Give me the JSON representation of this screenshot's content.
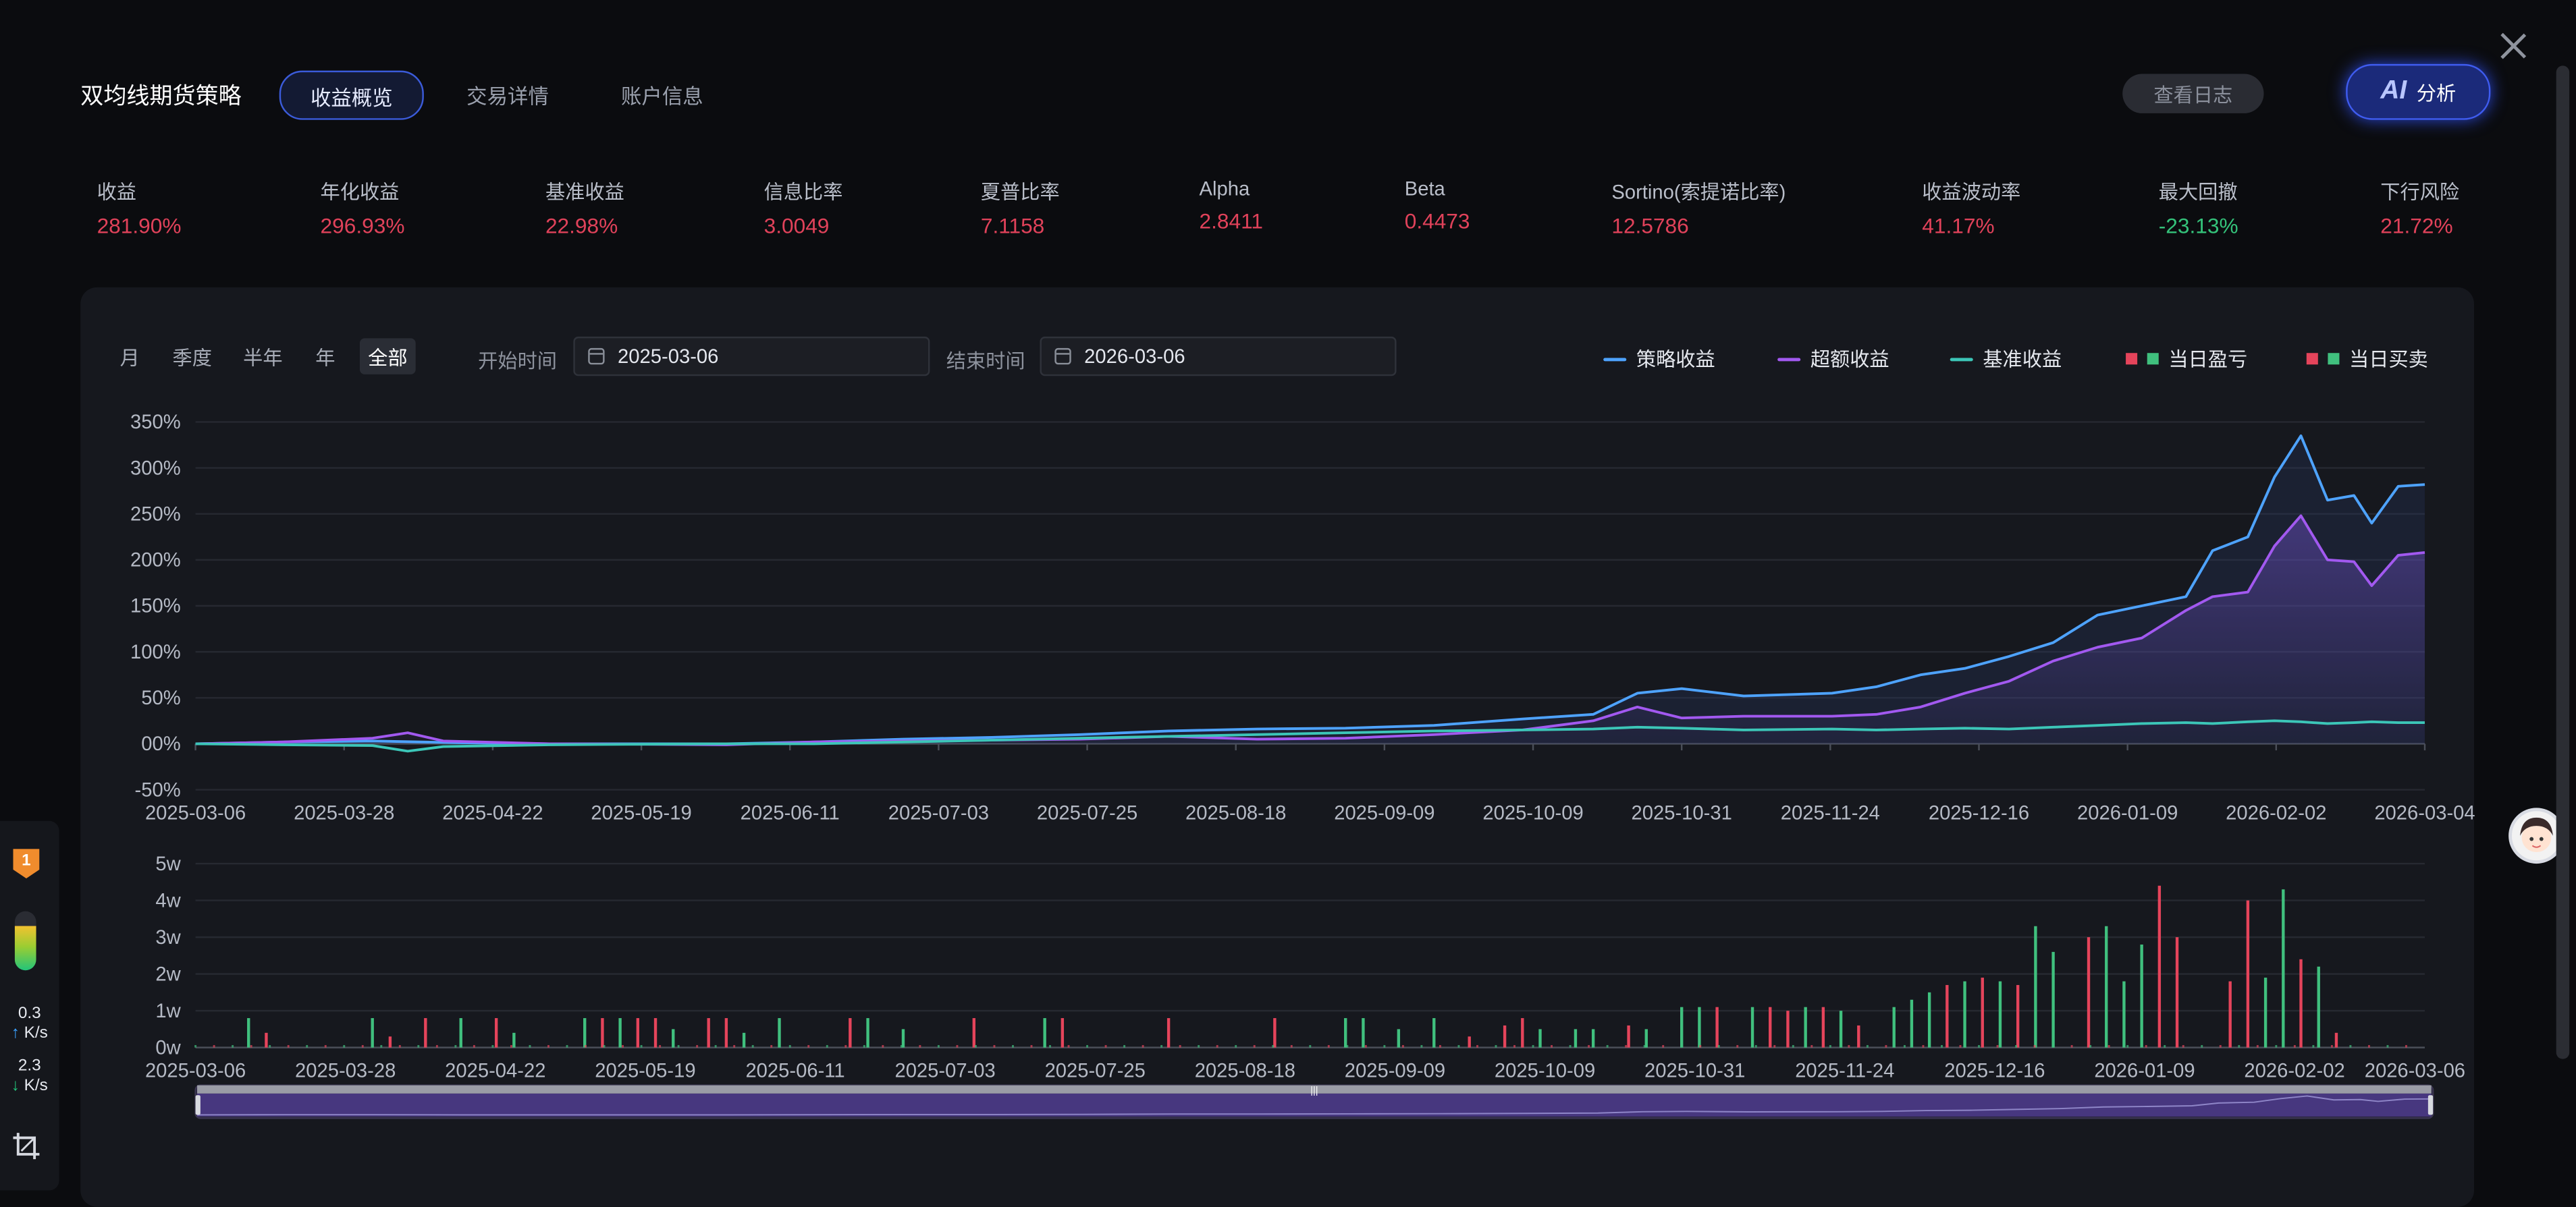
{
  "header": {
    "strategy_title": "双均线期货策略",
    "tabs": [
      {
        "label": "收益概览",
        "active": true
      },
      {
        "label": "交易详情",
        "active": false
      },
      {
        "label": "账户信息",
        "active": false
      }
    ],
    "log_button": "查看日志",
    "ai_button": {
      "ai": "AI",
      "label": "分析"
    }
  },
  "metrics": [
    {
      "label": "收益",
      "value": "281.90%",
      "tone": "red"
    },
    {
      "label": "年化收益",
      "value": "296.93%",
      "tone": "red"
    },
    {
      "label": "基准收益",
      "value": "22.98%",
      "tone": "red"
    },
    {
      "label": "信息比率",
      "value": "3.0049",
      "tone": "red"
    },
    {
      "label": "夏普比率",
      "value": "7.1158",
      "tone": "red"
    },
    {
      "label": "Alpha",
      "value": "2.8411",
      "tone": "red"
    },
    {
      "label": "Beta",
      "value": "0.4473",
      "tone": "red"
    },
    {
      "label": "Sortino(索提诺比率)",
      "value": "12.5786",
      "tone": "red"
    },
    {
      "label": "收益波动率",
      "value": "41.17%",
      "tone": "red"
    },
    {
      "label": "最大回撤",
      "value": "-23.13%",
      "tone": "green"
    },
    {
      "label": "下行风险",
      "value": "21.72%",
      "tone": "red"
    }
  ],
  "controls": {
    "periods": [
      {
        "label": "月",
        "active": false
      },
      {
        "label": "季度",
        "active": false
      },
      {
        "label": "半年",
        "active": false
      },
      {
        "label": "年",
        "active": false
      },
      {
        "label": "全部",
        "active": true
      }
    ],
    "start_label": "开始时间",
    "start_value": "2025-03-06",
    "end_label": "结束时间",
    "end_value": "2026-03-06"
  },
  "legend": [
    {
      "label": "策略收益",
      "kind": "line",
      "color": "#4ea3ff"
    },
    {
      "label": "超额收益",
      "kind": "line",
      "color": "#a259f0"
    },
    {
      "label": "基准收益",
      "kind": "line",
      "color": "#3cc6b8"
    },
    {
      "label": "当日盈亏",
      "kind": "squares",
      "colors": [
        "#e5445b",
        "#40c07e"
      ]
    },
    {
      "label": "当日买卖",
      "kind": "squares",
      "colors": [
        "#e5445b",
        "#40c07e"
      ]
    }
  ],
  "colors": {
    "strategy": "#4ea3ff",
    "excess": "#a259f0",
    "benchmark": "#3cc6b8",
    "up": "#e5445b",
    "down": "#40c07e"
  },
  "chart_data": [
    {
      "type": "line",
      "ylim": [
        -50,
        350
      ],
      "y_ticks": [
        "350%",
        "300%",
        "250%",
        "200%",
        "150%",
        "100%",
        "50%",
        "00%",
        "-50%"
      ],
      "x_ticks": [
        "2025-03-06",
        "2025-03-28",
        "2025-04-22",
        "2025-05-19",
        "2025-06-11",
        "2025-07-03",
        "2025-07-25",
        "2025-08-18",
        "2025-09-09",
        "2025-10-09",
        "2025-10-31",
        "2025-11-24",
        "2025-12-16",
        "2026-01-09",
        "2026-02-02",
        "2026-03-04"
      ],
      "x_range": [
        0,
        246
      ],
      "series": [
        {
          "name": "策略收益",
          "points": [
            [
              0,
              0
            ],
            [
              10,
              2
            ],
            [
              20,
              3
            ],
            [
              30,
              1
            ],
            [
              40,
              0
            ],
            [
              60,
              0
            ],
            [
              70,
              2
            ],
            [
              80,
              5
            ],
            [
              90,
              7
            ],
            [
              100,
              10
            ],
            [
              110,
              14
            ],
            [
              120,
              16
            ],
            [
              130,
              17
            ],
            [
              140,
              20
            ],
            [
              150,
              27
            ],
            [
              158,
              32
            ],
            [
              163,
              55
            ],
            [
              168,
              60
            ],
            [
              175,
              52
            ],
            [
              185,
              55
            ],
            [
              190,
              62
            ],
            [
              195,
              75
            ],
            [
              200,
              82
            ],
            [
              205,
              95
            ],
            [
              210,
              110
            ],
            [
              215,
              140
            ],
            [
              220,
              150
            ],
            [
              225,
              160
            ],
            [
              228,
              210
            ],
            [
              232,
              225
            ],
            [
              235,
              290
            ],
            [
              238,
              335
            ],
            [
              241,
              265
            ],
            [
              244,
              270
            ],
            [
              246,
              240
            ],
            [
              249,
              280
            ],
            [
              252,
              282
            ]
          ]
        },
        {
          "name": "超额收益",
          "points": [
            [
              0,
              0
            ],
            [
              10,
              2
            ],
            [
              20,
              6
            ],
            [
              24,
              12
            ],
            [
              28,
              3
            ],
            [
              40,
              0
            ],
            [
              60,
              -1
            ],
            [
              70,
              2
            ],
            [
              80,
              3
            ],
            [
              90,
              4
            ],
            [
              100,
              5
            ],
            [
              110,
              8
            ],
            [
              120,
              5
            ],
            [
              130,
              6
            ],
            [
              140,
              10
            ],
            [
              150,
              15
            ],
            [
              158,
              25
            ],
            [
              163,
              40
            ],
            [
              168,
              28
            ],
            [
              175,
              30
            ],
            [
              185,
              30
            ],
            [
              190,
              32
            ],
            [
              195,
              40
            ],
            [
              200,
              55
            ],
            [
              205,
              68
            ],
            [
              210,
              90
            ],
            [
              215,
              105
            ],
            [
              220,
              115
            ],
            [
              225,
              145
            ],
            [
              228,
              160
            ],
            [
              232,
              165
            ],
            [
              235,
              215
            ],
            [
              238,
              248
            ],
            [
              241,
              200
            ],
            [
              244,
              198
            ],
            [
              246,
              172
            ],
            [
              249,
              205
            ],
            [
              252,
              208
            ]
          ]
        },
        {
          "name": "基准收益",
          "points": [
            [
              0,
              0
            ],
            [
              10,
              -1
            ],
            [
              20,
              -2
            ],
            [
              24,
              -8
            ],
            [
              28,
              -3
            ],
            [
              40,
              -1
            ],
            [
              60,
              0
            ],
            [
              70,
              0
            ],
            [
              80,
              2
            ],
            [
              90,
              4
            ],
            [
              100,
              6
            ],
            [
              110,
              8
            ],
            [
              120,
              10
            ],
            [
              130,
              12
            ],
            [
              140,
              14
            ],
            [
              150,
              15
            ],
            [
              158,
              16
            ],
            [
              163,
              18
            ],
            [
              168,
              17
            ],
            [
              175,
              15
            ],
            [
              185,
              16
            ],
            [
              190,
              15
            ],
            [
              195,
              16
            ],
            [
              200,
              17
            ],
            [
              205,
              16
            ],
            [
              210,
              18
            ],
            [
              215,
              20
            ],
            [
              220,
              22
            ],
            [
              225,
              23
            ],
            [
              228,
              22
            ],
            [
              232,
              24
            ],
            [
              235,
              25
            ],
            [
              238,
              24
            ],
            [
              241,
              22
            ],
            [
              244,
              23
            ],
            [
              246,
              24
            ],
            [
              249,
              23
            ],
            [
              252,
              23
            ]
          ]
        }
      ]
    },
    {
      "type": "bar",
      "ylim": [
        0,
        5
      ],
      "y_ticks": [
        "5w",
        "4w",
        "3w",
        "2w",
        "1w",
        "0w"
      ],
      "x_ticks": [
        "2025-03-06",
        "2025-03-28",
        "2025-04-22",
        "2025-05-19",
        "2025-06-11",
        "2025-07-03",
        "2025-07-25",
        "2025-08-18",
        "2025-09-09",
        "2025-10-09",
        "2025-10-31",
        "2025-11-24",
        "2025-12-16",
        "2026-01-09",
        "2026-02-02",
        "2026-03-06"
      ],
      "bars": [
        [
          6,
          0.8,
          "g"
        ],
        [
          8,
          0.4,
          "r"
        ],
        [
          20,
          0.8,
          "g"
        ],
        [
          22,
          0.3,
          "r"
        ],
        [
          26,
          0.8,
          "r"
        ],
        [
          30,
          0.8,
          "g"
        ],
        [
          34,
          0.8,
          "r"
        ],
        [
          36,
          0.4,
          "g"
        ],
        [
          44,
          0.8,
          "g"
        ],
        [
          46,
          0.8,
          "r"
        ],
        [
          48,
          0.8,
          "g"
        ],
        [
          50,
          0.8,
          "r"
        ],
        [
          52,
          0.8,
          "r"
        ],
        [
          54,
          0.5,
          "g"
        ],
        [
          58,
          0.8,
          "r"
        ],
        [
          60,
          0.8,
          "r"
        ],
        [
          62,
          0.4,
          "g"
        ],
        [
          66,
          0.8,
          "g"
        ],
        [
          74,
          0.8,
          "r"
        ],
        [
          76,
          0.8,
          "g"
        ],
        [
          80,
          0.5,
          "g"
        ],
        [
          88,
          0.8,
          "r"
        ],
        [
          96,
          0.8,
          "g"
        ],
        [
          98,
          0.8,
          "r"
        ],
        [
          110,
          0.8,
          "r"
        ],
        [
          122,
          0.8,
          "r"
        ],
        [
          130,
          0.8,
          "g"
        ],
        [
          132,
          0.8,
          "g"
        ],
        [
          136,
          0.5,
          "g"
        ],
        [
          140,
          0.8,
          "g"
        ],
        [
          144,
          0.3,
          "r"
        ],
        [
          148,
          0.6,
          "r"
        ],
        [
          150,
          0.8,
          "r"
        ],
        [
          152,
          0.5,
          "g"
        ],
        [
          156,
          0.5,
          "g"
        ],
        [
          158,
          0.5,
          "g"
        ],
        [
          162,
          0.6,
          "r"
        ],
        [
          164,
          0.5,
          "g"
        ],
        [
          168,
          1.1,
          "g"
        ],
        [
          170,
          1.1,
          "g"
        ],
        [
          172,
          1.1,
          "r"
        ],
        [
          176,
          1.1,
          "g"
        ],
        [
          178,
          1.1,
          "r"
        ],
        [
          180,
          1.0,
          "r"
        ],
        [
          182,
          1.1,
          "g"
        ],
        [
          184,
          1.1,
          "r"
        ],
        [
          186,
          1.0,
          "g"
        ],
        [
          188,
          0.6,
          "r"
        ],
        [
          192,
          1.1,
          "g"
        ],
        [
          194,
          1.3,
          "g"
        ],
        [
          196,
          1.5,
          "g"
        ],
        [
          198,
          1.7,
          "r"
        ],
        [
          200,
          1.8,
          "g"
        ],
        [
          202,
          1.9,
          "r"
        ],
        [
          204,
          1.8,
          "g"
        ],
        [
          206,
          1.7,
          "r"
        ],
        [
          208,
          3.3,
          "g"
        ],
        [
          210,
          2.6,
          "g"
        ],
        [
          214,
          3.0,
          "r"
        ],
        [
          216,
          3.3,
          "g"
        ],
        [
          218,
          1.8,
          "g"
        ],
        [
          220,
          2.8,
          "g"
        ],
        [
          222,
          4.4,
          "r"
        ],
        [
          224,
          3.0,
          "r"
        ],
        [
          230,
          1.8,
          "r"
        ],
        [
          232,
          4.0,
          "r"
        ],
        [
          234,
          1.9,
          "g"
        ],
        [
          236,
          4.3,
          "g"
        ],
        [
          238,
          2.4,
          "r"
        ],
        [
          240,
          2.2,
          "g"
        ],
        [
          242,
          0.4,
          "r"
        ]
      ]
    }
  ],
  "left_widget": {
    "badge": "1",
    "up_speed": "0.3",
    "down_speed": "2.3",
    "unit": "K/s"
  }
}
